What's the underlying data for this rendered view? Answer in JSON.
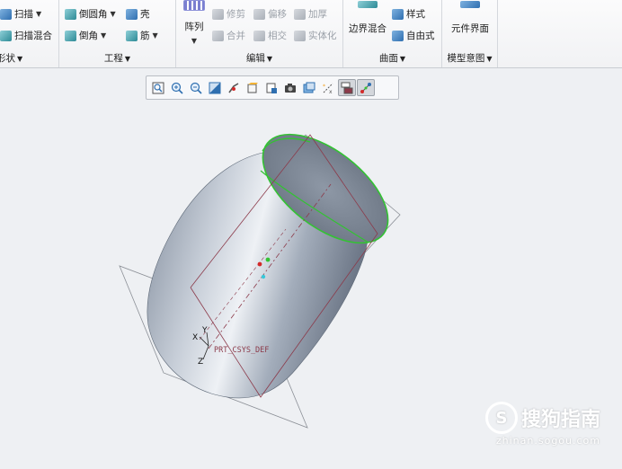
{
  "ribbon": {
    "shape_group": {
      "items": [
        "扫描",
        "扫描混合"
      ],
      "label": "形状"
    },
    "engineering_group": {
      "items": [
        "倒圆角",
        "壳",
        "倒角",
        "筋"
      ],
      "label": "工程"
    },
    "edit_group": {
      "array_label": "阵列",
      "items": [
        "修剪",
        "偏移",
        "加厚",
        "合并",
        "相交",
        "实体化"
      ],
      "label": "编辑"
    },
    "surface_group": {
      "items": [
        "边界混合",
        "样式",
        "自由式"
      ],
      "label": "曲面"
    },
    "model_intent_group": {
      "items": [
        "元件界面"
      ],
      "label": "模型意图"
    }
  },
  "view_toolbar": {
    "buttons": [
      "refit-icon",
      "zoom-in-icon",
      "zoom-out-icon",
      "repaint-icon",
      "spin-center-icon",
      "view-manager-icon",
      "saved-views-icon",
      "camera-icon",
      "display-style-icon",
      "datum-display-icon",
      "annotation-display-icon",
      "csys-display-icon"
    ]
  },
  "model": {
    "csys_label": "PRT_CSYS_DEF",
    "axis_x": "X",
    "axis_y": "Y",
    "axis_z": "Z"
  },
  "watermark": {
    "brand": "搜狗指南",
    "url": "zhinan.sogou.com"
  },
  "colors": {
    "body": "#9aa6b5",
    "highlight": "#3cc63c",
    "datum": "#8c3a4a"
  }
}
